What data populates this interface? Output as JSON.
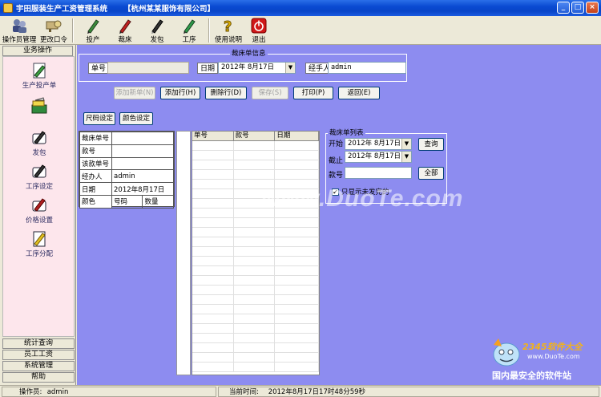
{
  "window": {
    "app_title": "宇田服装生产工资管理系统",
    "company": "【杭州某某服饰有限公司】",
    "min_label": "_",
    "max_label": "□",
    "close_label": "×"
  },
  "toolbar": {
    "operator_mgmt": "操作员管理",
    "change_password": "更改口令",
    "dispatch": "投产",
    "cutting": "裁床",
    "outsource": "发包",
    "process": "工序",
    "help": "使用说明",
    "exit": "退出"
  },
  "sidebar": {
    "header": "业务操作",
    "items": [
      {
        "label": "生产投产单",
        "icon": "production-order-icon"
      },
      {
        "label": "",
        "icon": "cutting-icon"
      },
      {
        "label": "发包",
        "icon": "outsource-icon"
      },
      {
        "label": "工序设定",
        "icon": "process-setup-icon"
      },
      {
        "label": "价格设置",
        "icon": "price-setup-icon"
      },
      {
        "label": "工序分配",
        "icon": "process-allocation-icon"
      }
    ],
    "bottom": [
      "统计查询",
      "员工工资",
      "系统管理",
      "帮助"
    ]
  },
  "cutting_info": {
    "group_title": "裁床单信息",
    "order_no_label": "单号",
    "order_no_value": "",
    "date_label": "日期",
    "date_value": "2012年 8月17日",
    "handler_label": "经手人",
    "handler_value": "admin"
  },
  "actions": {
    "add_new": "添加新单(N)",
    "add_row": "添加行(H)",
    "delete_row": "删除行(D)",
    "save": "保存(S)",
    "print": "打印(P)",
    "back": "返回(E)",
    "size_setup": "尺码设定",
    "color_setup": "颜色设定"
  },
  "form_table": {
    "rows": [
      {
        "label": "裁床单号",
        "value": ""
      },
      {
        "label": "款号",
        "value": ""
      },
      {
        "label": "该款单号",
        "value": ""
      },
      {
        "label": "经办人",
        "value": "admin"
      },
      {
        "label": "日期",
        "value": "2012年8月17日"
      }
    ],
    "last_row": [
      "颜色",
      "号码",
      "数量"
    ]
  },
  "list": {
    "headers": [
      "单号",
      "款号",
      "日期"
    ]
  },
  "cutting_list": {
    "group_title": "裁床单列表",
    "start_label": "开始",
    "start_value": "2012年 8月17日",
    "end_label": "截止",
    "end_value": "2012年 8月17日",
    "style_label": "款号",
    "style_value": "",
    "query": "查询",
    "all": "全部",
    "only_unfinished": "只显示未发完的",
    "only_unfinished_checked": true
  },
  "status": {
    "operator_label": "操作员:",
    "operator_value": "admin",
    "time_label": "当前时间:",
    "time_value": "2012年8月17日17时48分59秒"
  },
  "watermark": {
    "text": "www.DuoTe.com",
    "logo_text": "2345软件大全",
    "logo_url": "www.DuoTe.com",
    "slogan": "国内最安全的软件站"
  }
}
